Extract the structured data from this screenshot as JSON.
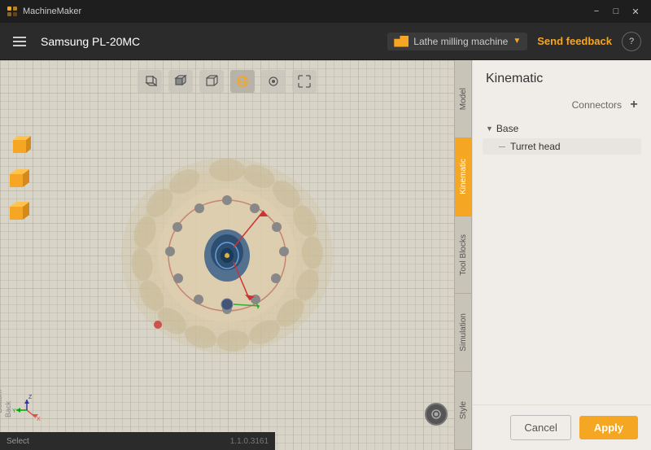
{
  "app": {
    "title": "MachineMaker",
    "window_title": "MachineMaker"
  },
  "titlebar": {
    "title": "MachineMaker",
    "minimize_label": "−",
    "maximize_label": "□",
    "close_label": "✕"
  },
  "toolbar": {
    "title": "Samsung PL-20MC",
    "machine_type": "Lathe milling machine",
    "send_feedback": "Send feedback",
    "help_label": "?"
  },
  "viewport": {
    "icons": [
      "□",
      "□",
      "□",
      "◎",
      "●",
      "✕"
    ]
  },
  "side_tabs": [
    {
      "id": "model",
      "label": "Model",
      "active": false
    },
    {
      "id": "kinematic",
      "label": "Kinematic",
      "active": true
    },
    {
      "id": "tool-blocks",
      "label": "Tool Blocks",
      "active": false
    },
    {
      "id": "simulation",
      "label": "Simulation",
      "active": false
    },
    {
      "id": "style",
      "label": "Style",
      "active": false
    }
  ],
  "panel": {
    "title": "Kinematic",
    "connectors_label": "Connectors",
    "add_label": "+",
    "tree": [
      {
        "label": "Base",
        "expanded": true,
        "children": [
          {
            "label": "Turret head"
          }
        ]
      }
    ],
    "cancel_label": "Cancel",
    "apply_label": "Apply"
  },
  "status": {
    "left": "Select",
    "right": "1.1.0.3161"
  },
  "axis": {
    "x": "X",
    "y": "Y",
    "z": "Z"
  }
}
